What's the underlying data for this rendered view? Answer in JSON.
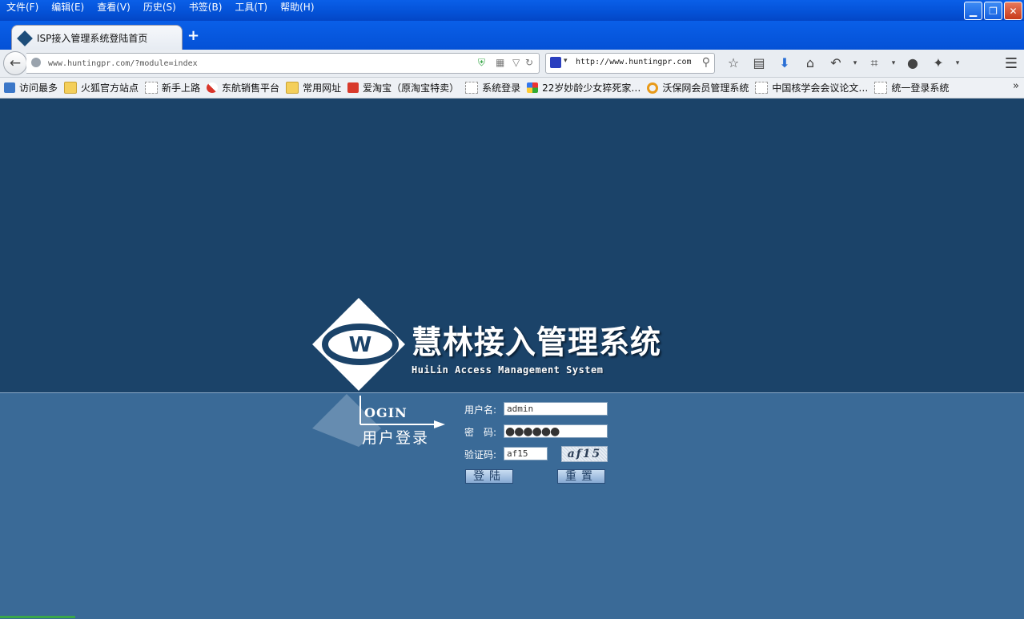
{
  "browser": {
    "menu": [
      "文件(F)",
      "编辑(E)",
      "查看(V)",
      "历史(S)",
      "书签(B)",
      "工具(T)",
      "帮助(H)"
    ],
    "tab_title": "ISP接入管理系统登陆首页",
    "new_tab": "+",
    "url": "www.huntingpr.com/?module=index",
    "search_value": "http://www.huntingpr.com",
    "bookmarks": [
      "访问最多",
      "火狐官方站点",
      "新手上路",
      "东航销售平台",
      "常用网址",
      "爱淘宝（原淘宝特卖）",
      "系统登录",
      "22岁妙龄少女猝死家…",
      "沃保网会员管理系统",
      "中国核学会会议论文…",
      "统一登录系统"
    ],
    "bookmarks_more": "»"
  },
  "page": {
    "brand_cn": "慧林接入管理系统",
    "brand_en": "HuiLin Access Management System",
    "logo_letter": "W",
    "login_word": "OGIN",
    "login_cn": "用户登录",
    "username_label": "用户名:",
    "username_value": "admin",
    "password_label": "密　码:",
    "password_mask": "●●●●●●",
    "captcha_label": "验证码:",
    "captcha_value": "af15",
    "captcha_image_text": "af15",
    "login_button": "登陆",
    "reset_button": "重置"
  }
}
